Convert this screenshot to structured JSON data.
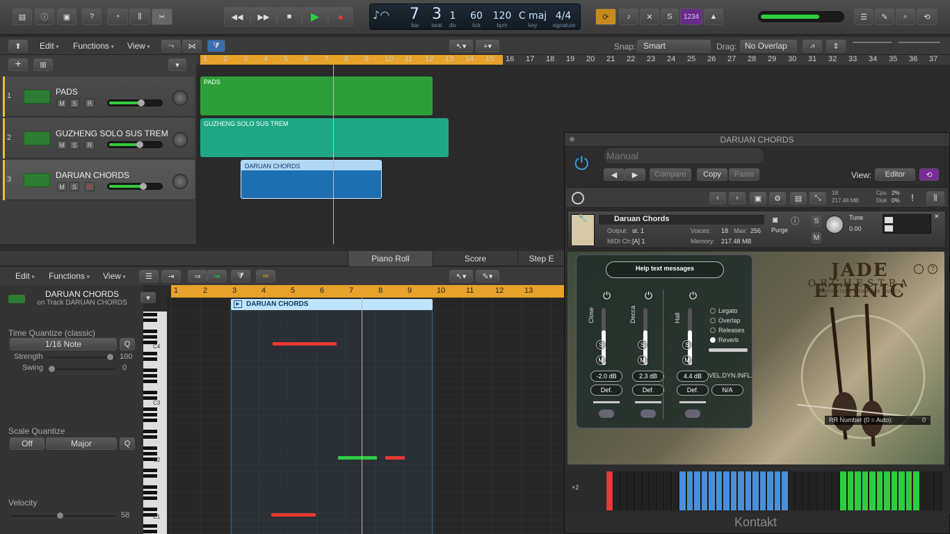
{
  "lcd": {
    "bar": "7",
    "beat": "3",
    "div": "1",
    "tick": "60",
    "bpm": "120",
    "key": "C maj",
    "signature": "4/4",
    "labels": {
      "bar": "bar",
      "beat": "beat",
      "div": "div",
      "tick": "tick",
      "bpm": "bpm",
      "key": "key",
      "signature": "signature"
    }
  },
  "master_volume": 0.72,
  "cycle_text": "1234",
  "tracks_toolbar": {
    "edit": "Edit",
    "functions": "Functions",
    "view": "View",
    "snap_label": "Snap:",
    "snap_value": "Smart",
    "drag_label": "Drag:",
    "drag_value": "No Overlap"
  },
  "ruler_numbers": [
    "1",
    "2",
    "3",
    "4",
    "5",
    "6",
    "7",
    "8",
    "9",
    "10",
    "11",
    "12",
    "13",
    "14",
    "15",
    "16",
    "17",
    "18",
    "19",
    "20",
    "21",
    "22",
    "23",
    "24",
    "25",
    "26",
    "27",
    "28",
    "29",
    "30",
    "31",
    "32",
    "33",
    "34",
    "35",
    "36",
    "37"
  ],
  "cycle_range": {
    "start": 1,
    "end": 15
  },
  "playhead_bar": 7.6,
  "tracks": [
    {
      "num": "1",
      "name": "PADS",
      "m": "M",
      "s": "S",
      "r": "R",
      "volume": 0.75,
      "armed": false
    },
    {
      "num": "2",
      "name": "GUZHENG SOLO SUS TREM",
      "m": "M",
      "s": "S",
      "r": "R",
      "volume": 0.72,
      "armed": false
    },
    {
      "num": "3",
      "name": "DARUAN CHORDS",
      "m": "M",
      "s": "S",
      "r": "R",
      "volume": 0.8,
      "armed": true
    }
  ],
  "regions": [
    {
      "name": "PADS",
      "track": 0,
      "start": 1,
      "end": 12.5,
      "color": "#2e9e3a"
    },
    {
      "name": "GUZHENG SOLO SUS TREM",
      "track": 1,
      "start": 1,
      "end": 13.3,
      "color": "#1fa886"
    },
    {
      "name": "DARUAN CHORDS",
      "track": 2,
      "start": 3,
      "end": 10,
      "color": "#1e6fb0"
    }
  ],
  "editor_tabs": {
    "piano_roll": "Piano Roll",
    "score": "Score",
    "step": "Step E"
  },
  "pr_toolbar": {
    "edit": "Edit",
    "functions": "Functions",
    "view": "View"
  },
  "pr_inspector": {
    "region_name": "DARUAN CHORDS",
    "region_sub": "on Track DARUAN CHORDS",
    "time_quantize_label": "Time Quantize (classic)",
    "time_quantize_value": "1/16 Note",
    "q": "Q",
    "strength_label": "Strength",
    "strength_value": "100",
    "swing_label": "Swing",
    "swing_value": "0",
    "scale_quantize_label": "Scale Quantize",
    "scale_off": "Off",
    "scale_major": "Major",
    "velocity_label": "Velocity",
    "velocity_value": "58"
  },
  "pr_ruler_numbers": [
    "1",
    "2",
    "3",
    "4",
    "5",
    "6",
    "7",
    "8",
    "9",
    "10",
    "11",
    "12",
    "13"
  ],
  "pr_region_label": "DARUAN CHORDS",
  "key_labels": [
    "C4",
    "C3",
    "C2",
    "C1"
  ],
  "kontakt": {
    "title": "DARUAN CHORDS",
    "preset": "Manual",
    "compare": "Compare",
    "copy": "Copy",
    "paste": "Paste",
    "view_label": "View:",
    "view_value": "Editor",
    "voices_stat": "18",
    "mem_stat": "217.48 MB",
    "cpu_label": "Cpu",
    "cpu_value": "2%",
    "disk_label": "Disk",
    "disk_value": "0%",
    "inst_name": "Daruan Chords",
    "output_label": "Output:",
    "output_value": "st. 1",
    "voices_label": "Voices:",
    "voices_value": "18",
    "max_label": "Max:",
    "max_value": "256",
    "midi_label": "MIDI Ch:",
    "midi_value": "[A]  1",
    "memory_label": "Memory:",
    "memory_value": "217.48 MB",
    "purge": "Purge",
    "tune_label": "Tune",
    "tune_value": "0.00",
    "s_btn": "S",
    "m_btn": "M",
    "help": "Help text messages",
    "mics": [
      {
        "label": "Close",
        "db": "-2.0 dB",
        "def": "Def."
      },
      {
        "label": "Decca",
        "db": "2.3 dB",
        "def": "Def."
      },
      {
        "label": "Hall",
        "db": "4.4 dB",
        "def": "Def."
      }
    ],
    "options": [
      "Legato",
      "Overlap",
      "Releases",
      "Reverb"
    ],
    "vel_label": "VEL.DYN.INFL.",
    "vel_value": "N/A",
    "logo_title": "JADE ETHNIC",
    "logo_sub": "ORCHESTRA",
    "logo_tag": "INSPIRATION FROM THE ROOTS",
    "rr_label": "RR Number (0 = Auto):",
    "rr_value": "0",
    "octave": "+2",
    "footer": "Kontakt"
  },
  "colors": {
    "accent_green": "#2ecc40",
    "cycle_yellow": "#e6a22a",
    "region_blue": "#1e6fb0",
    "record_red": "#e53935"
  }
}
